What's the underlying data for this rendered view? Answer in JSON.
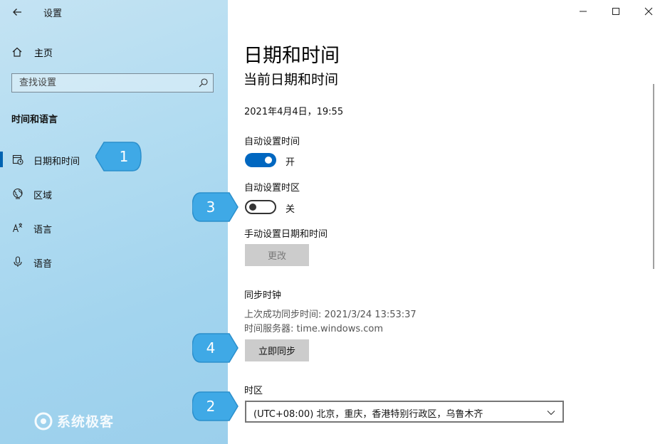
{
  "window": {
    "title": "设置",
    "controls": {
      "minimize": "minimize-icon",
      "maximize": "maximize-icon",
      "close": "close-icon"
    }
  },
  "sidebar": {
    "home_label": "主页",
    "search_placeholder": "查找设置",
    "section_title": "时间和语言",
    "items": [
      {
        "label": "日期和时间",
        "icon": "calendar-clock-icon",
        "active": true
      },
      {
        "label": "区域",
        "icon": "globe-icon",
        "active": false
      },
      {
        "label": "语言",
        "icon": "language-icon",
        "active": false
      },
      {
        "label": "语音",
        "icon": "microphone-icon",
        "active": false
      }
    ],
    "watermark": "系统极客"
  },
  "main": {
    "title": "日期和时间",
    "subtitle": "当前日期和时间",
    "current_datetime": "2021年4月4日，19:55",
    "auto_time": {
      "label": "自动设置时间",
      "state": "开",
      "on": true
    },
    "auto_timezone": {
      "label": "自动设置时区",
      "state": "关",
      "on": false
    },
    "manual": {
      "label": "手动设置日期和时间",
      "button": "更改"
    },
    "sync": {
      "label": "同步时钟",
      "last_sync": "上次成功同步时间: 2021/3/24 13:53:37",
      "server": "时间服务器: time.windows.com",
      "button": "立即同步"
    },
    "timezone": {
      "label": "时区",
      "value": "(UTC+08:00) 北京，重庆，香港特别行政区，乌鲁木齐"
    }
  },
  "callouts": [
    "1",
    "3",
    "4",
    "2"
  ],
  "colors": {
    "accent": "#0067c0",
    "callout": "#3fa9e6",
    "sidebar_bg": "#a8d6ef"
  }
}
